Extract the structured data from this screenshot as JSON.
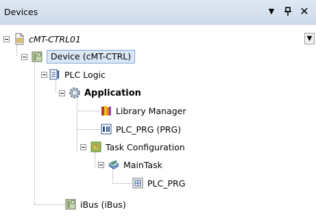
{
  "panel": {
    "title": "Devices",
    "dropdown_glyph": "▾",
    "pin_glyph": "ᵖ",
    "close_glyph": "×"
  },
  "tree": {
    "project": "cMT-CTRL01",
    "device": "Device (cMT-CTRL)",
    "plc_logic": "PLC Logic",
    "application": "Application",
    "library_manager": "Library Manager",
    "plc_prg_pou": "PLC_PRG (PRG)",
    "task_configuration": "Task Configuration",
    "main_task": "MainTask",
    "plc_prg_call": "PLC_PRG",
    "ibus": "iBus (iBus)"
  },
  "icons": {
    "project": "project-file-icon",
    "device": "device-icon",
    "plc_logic": "plc-logic-icon",
    "application": "application-gear-icon",
    "library_manager": "library-books-icon",
    "plc_prg_pou": "program-pou-icon",
    "task_configuration": "task-configuration-icon",
    "main_task": "task-icon",
    "plc_prg_call": "program-call-icon",
    "ibus": "ibus-device-icon"
  }
}
